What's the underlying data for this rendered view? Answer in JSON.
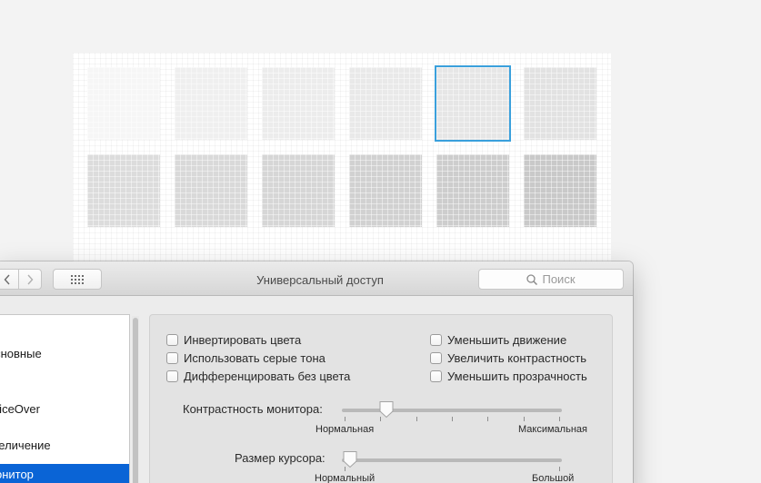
{
  "window": {
    "title": "Универсальный доступ",
    "search_placeholder": "Поиск",
    "back_glyph": "‹",
    "forward_glyph": "›",
    "grid_glyph": "⋮⋮⋮"
  },
  "sidebar": {
    "items": [
      {
        "label": "Основные",
        "active": false
      },
      {
        "label": "VoiceOver",
        "active": false
      },
      {
        "label": "Увеличение",
        "active": false
      },
      {
        "label": "Монитор",
        "active": true
      }
    ]
  },
  "options": {
    "left": [
      {
        "label": "Инвертировать цвета",
        "checked": false
      },
      {
        "label": "Использовать серые тона",
        "checked": false
      },
      {
        "label": "Дифференцировать без цвета",
        "checked": false
      }
    ],
    "right": [
      {
        "label": "Уменьшить движение",
        "checked": false
      },
      {
        "label": "Увеличить контрастность",
        "checked": false
      },
      {
        "label": "Уменьшить прозрачность",
        "checked": false
      }
    ]
  },
  "contrast_slider": {
    "label": "Контрастность монитора:",
    "min_label": "Нормальная",
    "max_label": "Максимальная",
    "value": 0.18,
    "ticks": 7
  },
  "cursor_slider": {
    "label": "Размер курсора:",
    "min_label": "Нормальный",
    "max_label": "Большой",
    "value": 0.0
  },
  "swatches": {
    "selected_index": 4,
    "colors": [
      "#f6f6f6",
      "#efefef",
      "#ececec",
      "#e9e9e9",
      "#e6e6e6",
      "#e2e2e2",
      "#dcdcdc",
      "#d9d9d9",
      "#d6d6d6",
      "#d1d1d1",
      "#cdcdcd",
      "#c9c9c9"
    ]
  },
  "colors": {
    "selection_blue": "#0a64d6",
    "swatch_outline": "#3aa0dc"
  }
}
